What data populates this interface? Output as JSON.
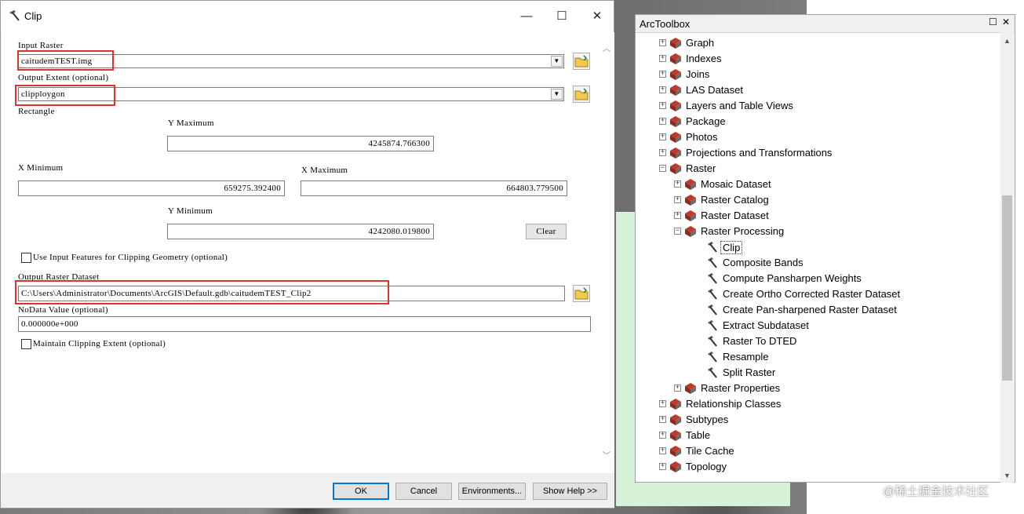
{
  "dialog": {
    "title": "Clip",
    "window_controls": {
      "minimize": "—",
      "maximize": "☐",
      "close": "✕"
    },
    "input_raster": {
      "label": "Input Raster",
      "value": "caitudemTEST.img"
    },
    "output_extent": {
      "label": "Output Extent (optional)",
      "value": "clipploygon"
    },
    "rectangle_label": "Rectangle",
    "y_maximum": {
      "label": "Y Maximum",
      "value": "4245874.766300"
    },
    "x_minimum": {
      "label": "X Minimum",
      "value": "659275.392400"
    },
    "x_maximum": {
      "label": "X Maximum",
      "value": "664803.779500"
    },
    "y_minimum": {
      "label": "Y Minimum",
      "value": "4242080.019800"
    },
    "clear_label": "Clear",
    "use_input_features": {
      "label": "Use Input Features for Clipping Geometry (optional)",
      "checked": false
    },
    "output_raster": {
      "label": "Output Raster Dataset",
      "value": "C:\\Users\\Administrator\\Documents\\ArcGIS\\Default.gdb\\caitudemTEST_Clip2"
    },
    "nodata": {
      "label": "NoData Value (optional)",
      "value": "0.000000e+000"
    },
    "maintain_extent": {
      "label": "Maintain Clipping Extent (optional)",
      "checked": false
    },
    "buttons": {
      "ok": "OK",
      "cancel": "Cancel",
      "environments": "Environments...",
      "show_help": "Show Help >>"
    }
  },
  "toolbox": {
    "title": "ArcToolbox",
    "items": [
      {
        "label": "Graph",
        "level": 0,
        "type": "toolset",
        "expander": "+"
      },
      {
        "label": "Indexes",
        "level": 0,
        "type": "toolset",
        "expander": "+"
      },
      {
        "label": "Joins",
        "level": 0,
        "type": "toolset",
        "expander": "+"
      },
      {
        "label": "LAS Dataset",
        "level": 0,
        "type": "toolset",
        "expander": "+"
      },
      {
        "label": "Layers and Table Views",
        "level": 0,
        "type": "toolset",
        "expander": "+"
      },
      {
        "label": "Package",
        "level": 0,
        "type": "toolset",
        "expander": "+"
      },
      {
        "label": "Photos",
        "level": 0,
        "type": "toolset",
        "expander": "+"
      },
      {
        "label": "Projections and Transformations",
        "level": 0,
        "type": "toolset",
        "expander": "+"
      },
      {
        "label": "Raster",
        "level": 0,
        "type": "toolset",
        "expander": "−"
      },
      {
        "label": "Mosaic Dataset",
        "level": 1,
        "type": "toolset",
        "expander": "+"
      },
      {
        "label": "Raster Catalog",
        "level": 1,
        "type": "toolset",
        "expander": "+"
      },
      {
        "label": "Raster Dataset",
        "level": 1,
        "type": "toolset",
        "expander": "+"
      },
      {
        "label": "Raster Processing",
        "level": 1,
        "type": "toolset",
        "expander": "−"
      },
      {
        "label": "Clip",
        "level": 2,
        "type": "tool",
        "selected": true
      },
      {
        "label": "Composite Bands",
        "level": 2,
        "type": "tool"
      },
      {
        "label": "Compute Pansharpen Weights",
        "level": 2,
        "type": "tool"
      },
      {
        "label": "Create Ortho Corrected Raster Dataset",
        "level": 2,
        "type": "tool"
      },
      {
        "label": "Create Pan-sharpened Raster Dataset",
        "level": 2,
        "type": "tool"
      },
      {
        "label": "Extract Subdataset",
        "level": 2,
        "type": "tool"
      },
      {
        "label": "Raster To DTED",
        "level": 2,
        "type": "tool"
      },
      {
        "label": "Resample",
        "level": 2,
        "type": "tool"
      },
      {
        "label": "Split Raster",
        "level": 2,
        "type": "tool"
      },
      {
        "label": "Raster Properties",
        "level": 1,
        "type": "toolset",
        "expander": "+"
      },
      {
        "label": "Relationship Classes",
        "level": 0,
        "type": "toolset",
        "expander": "+"
      },
      {
        "label": "Subtypes",
        "level": 0,
        "type": "toolset",
        "expander": "+"
      },
      {
        "label": "Table",
        "level": 0,
        "type": "toolset",
        "expander": "+"
      },
      {
        "label": "Tile Cache",
        "level": 0,
        "type": "toolset",
        "expander": "+"
      },
      {
        "label": "Topology",
        "level": 0,
        "type": "toolset",
        "expander": "+"
      }
    ]
  },
  "watermark": "@稀土掘金技术社区",
  "colors": {
    "highlight_box": "#e0322f",
    "default_button_border": "#0078d7",
    "toolbox_icon_red": "#c0392b"
  },
  "icons": {
    "tool": "hammer-icon",
    "toolset": "toolbox-icon",
    "browse": "folder-icon"
  }
}
